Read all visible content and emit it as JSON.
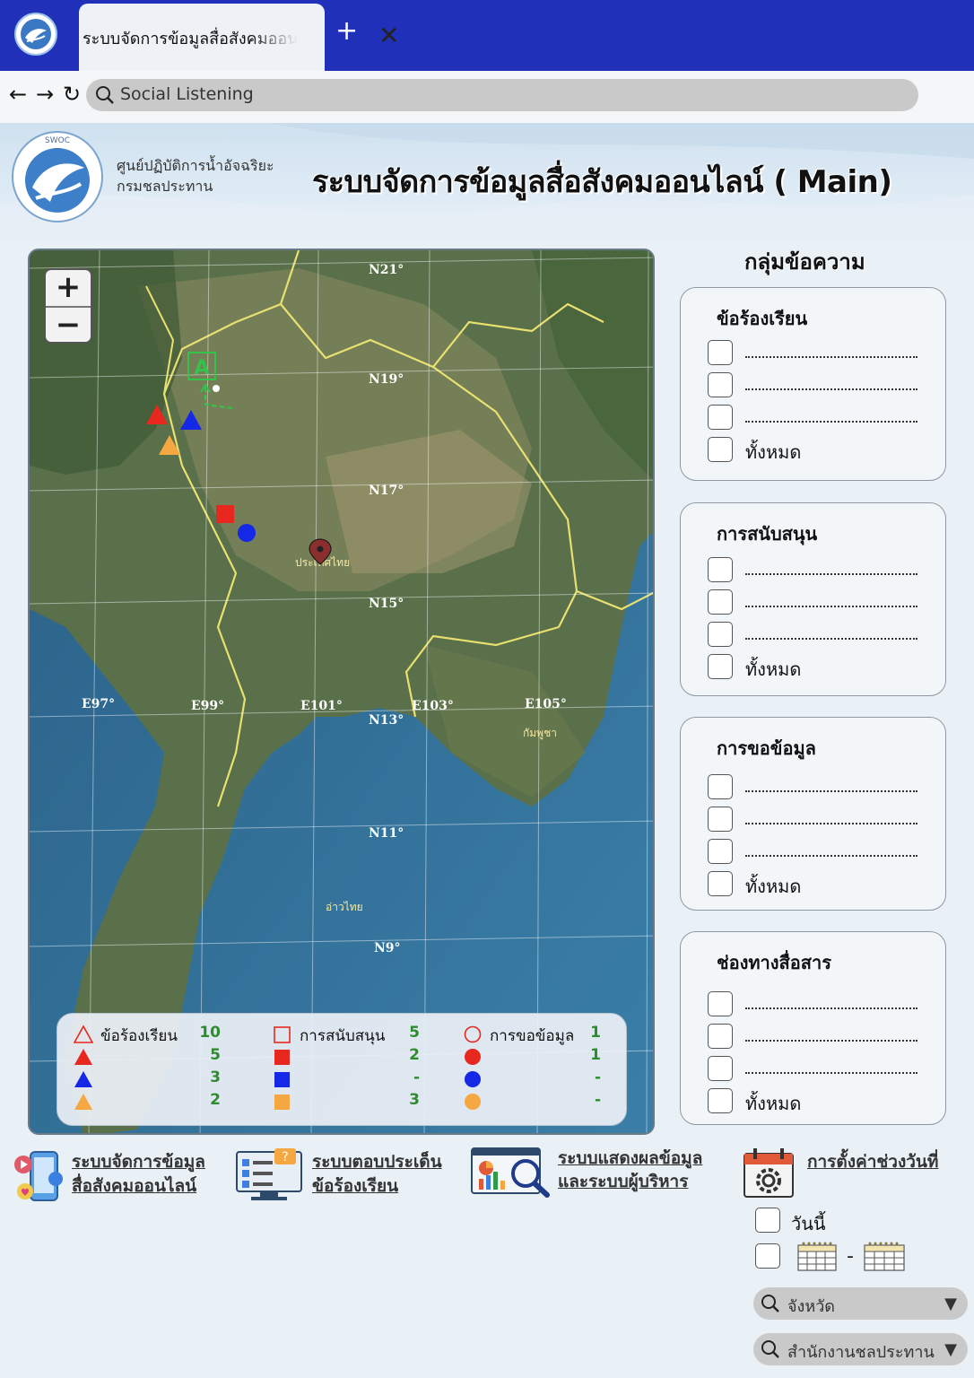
{
  "browser": {
    "tab_title": "ระบบจัดการข้อมูลสื่อสังคมออนไลน์",
    "close_glyph": "✕",
    "new_tab_glyph": "+",
    "back_glyph": "←",
    "forward_glyph": "→",
    "reload_glyph": "↻",
    "address": "Social Listening"
  },
  "header": {
    "org_line1": "ศูนย์ปฏิบัติการน้ำอัจฉริยะ",
    "org_line2": "กรมชลประทาน",
    "logo_text": "SWOC",
    "title": "ระบบจัดการข้อมูลสื่อสังคมออนไลน์ ( Main)"
  },
  "map": {
    "zoom_in": "+",
    "zoom_out": "−",
    "marker_label": "A",
    "grid_labels": {
      "n21": "N21°",
      "n19": "N19°",
      "n17": "N17°",
      "n15": "N15°",
      "n13": "N13°",
      "n11": "N11°",
      "n9": "N9°",
      "e97": "E97°",
      "e99": "E99°",
      "e101": "E101°",
      "e103": "E103°",
      "e105": "E105°"
    },
    "place_labels": {
      "thailand": "ประเทศไทย",
      "cambodia": "กัมพูชา",
      "gulf": "อ่าวไทย"
    }
  },
  "legend": {
    "complaint": {
      "label": "ข้อร้องเรียน",
      "total": "10",
      "red": "5",
      "blue": "3",
      "orange": "2"
    },
    "support": {
      "label": "การสนับสนุน",
      "total": "5",
      "red": "2",
      "blue": "-",
      "orange": "3"
    },
    "request": {
      "label": "การขอข้อมูล",
      "total": "1",
      "red": "1",
      "blue": "-",
      "orange": "-"
    }
  },
  "panel": {
    "title": "กลุ่มข้อความ",
    "all_label": "ทั้งหมด",
    "groups": [
      {
        "title": "ข้อร้องเรียน"
      },
      {
        "title": "การสนับสนุน"
      },
      {
        "title": "การขอข้อมูล"
      },
      {
        "title": "ช่องทางสื่อสาร"
      }
    ]
  },
  "bottom_nav": {
    "social": {
      "line1": "ระบบจัดการข้อมูล",
      "line2": "สื่อสังคมออนไลน์"
    },
    "response": {
      "line1": "ระบบตอบประเด็น",
      "line2": "ข้อร้องเรียน"
    },
    "dashboard": {
      "line1": "ระบบแสดงผลข้อมูล",
      "line2": "และระบบผู้บริหาร"
    },
    "date_settings": "การตั้งค่าช่วงวันที่"
  },
  "date_filter": {
    "today_label": "วันนี้",
    "range_dash": "-"
  },
  "filters": {
    "province_placeholder": "จังหวัด",
    "office_placeholder": "สำนักงานชลประทาน",
    "arrow_glyph": "▼"
  },
  "colors": {
    "tabbar": "#2030b8",
    "legend_number": "#2e8b2e",
    "red": "#e8281e",
    "blue": "#1428e6",
    "orange": "#f5a742"
  }
}
